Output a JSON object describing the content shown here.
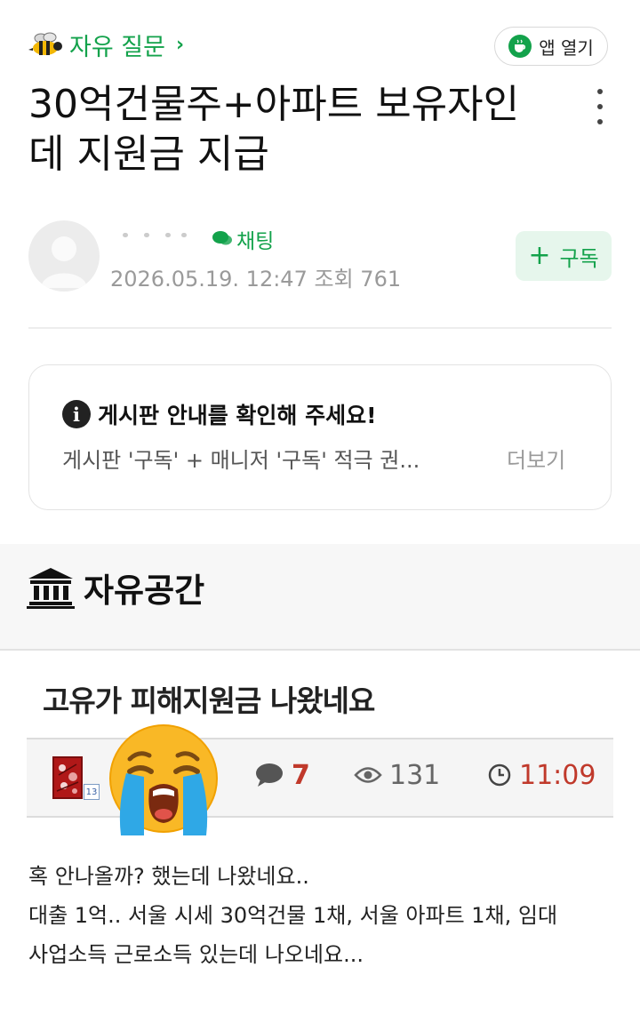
{
  "header": {
    "board_name": "자유 질문",
    "board_chevron": "›",
    "open_app_label": "앱 열기",
    "board_icon": "bee-icon",
    "accent_color": "#13a24b"
  },
  "post": {
    "title": "30억건물주+아파트 보유자인데 지원금 지급",
    "author": {
      "chat_label": "채팅",
      "date": "2026.05.19. 12:47",
      "views_label": "조회",
      "views": "761"
    },
    "subscribe_label": "구독",
    "subscribe_plus": "+"
  },
  "notice": {
    "title": "게시판 안내를 확인해 주세요!",
    "preview": "게시판 '구독' + 매니저 '구독' 적극 권...",
    "more_label": "더보기"
  },
  "section": {
    "title": "자유공간",
    "icon": "bank-icon"
  },
  "embedded": {
    "title": "고유가 피해지원금 나왔네요",
    "level": "13",
    "comments": "7",
    "views": "131",
    "time": "11:09",
    "emoji": "loudly-crying-face",
    "body_lines": [
      "혹 안나올까? 했는데 나왔네요..",
      "대출 1억.. 서울 시세 30억건물 1채, 서울 아파트 1채, 임대",
      "사업소득 근로소득 있는데 나오네요..."
    ]
  }
}
